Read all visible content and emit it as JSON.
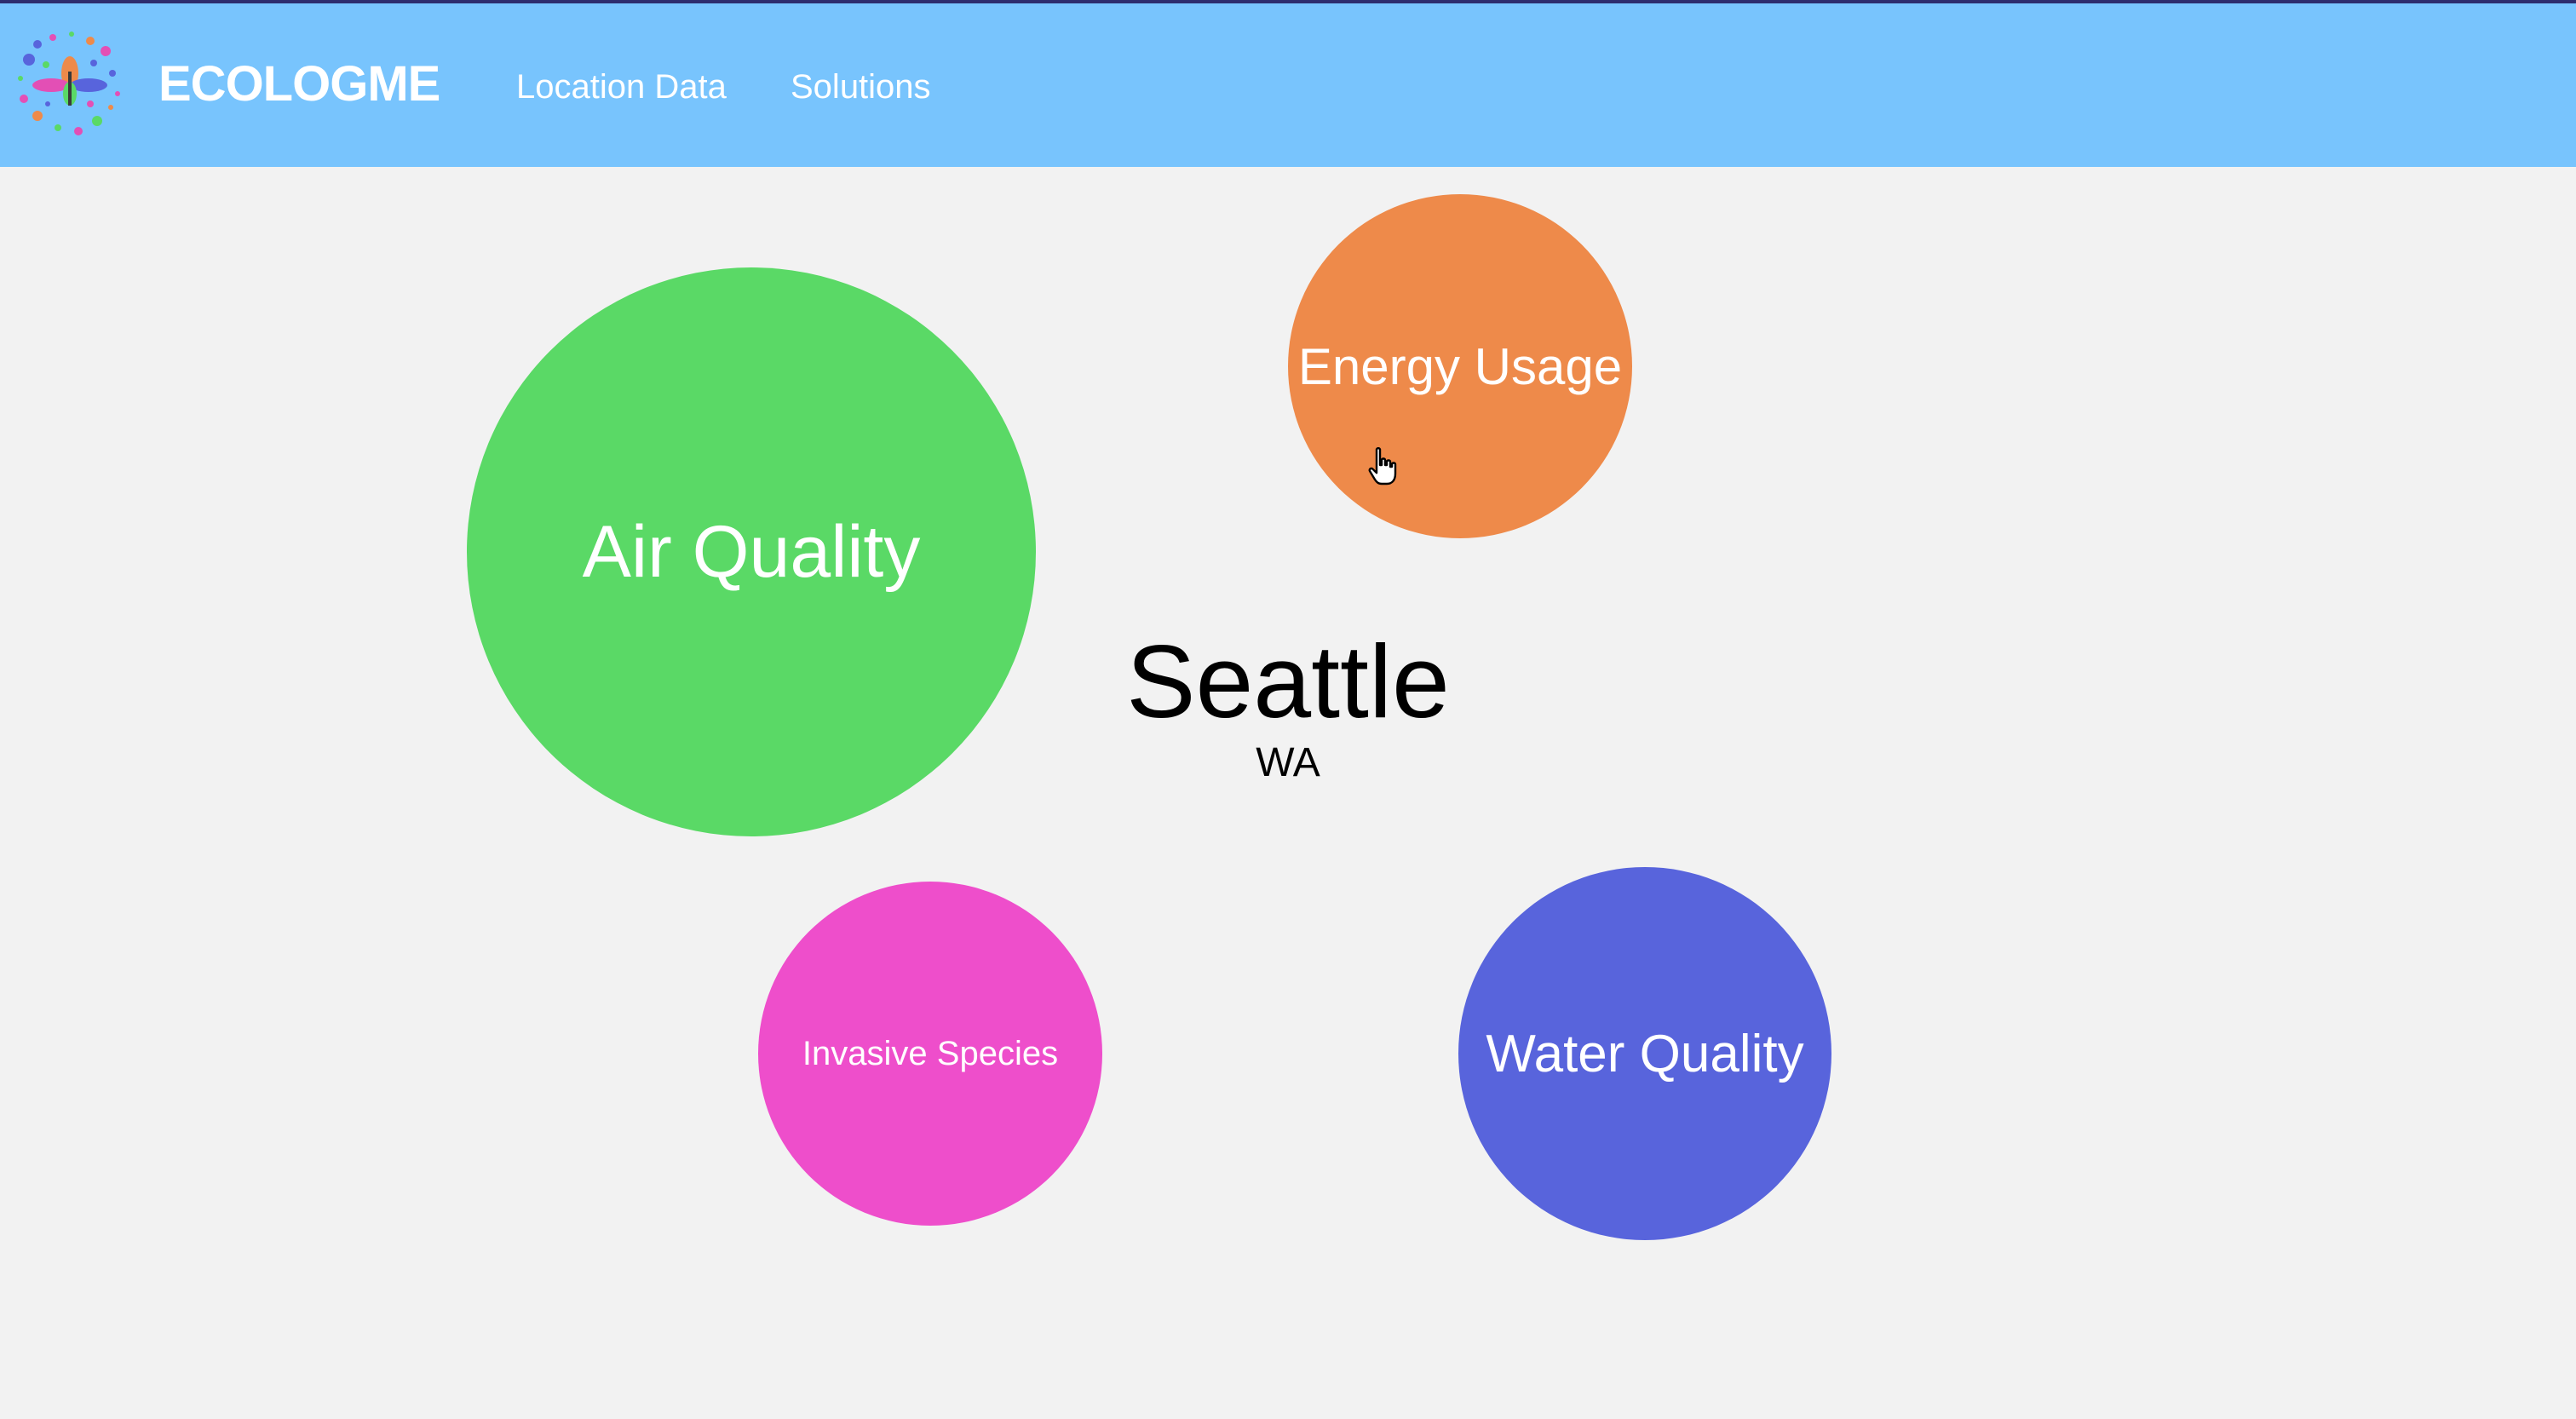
{
  "header": {
    "brand": "ECOLOGME",
    "nav": [
      {
        "label": "Location Data"
      },
      {
        "label": "Solutions"
      }
    ],
    "background_color": "#78c4fd"
  },
  "location": {
    "city": "Seattle",
    "state": "WA"
  },
  "categories": [
    {
      "label": "Air Quality",
      "color": "#5ad966"
    },
    {
      "label": "Energy Usage",
      "color": "#ee8a4a"
    },
    {
      "label": "Invasive Species",
      "color": "#ee4ecb"
    },
    {
      "label": "Water Quality",
      "color": "#5864dc"
    }
  ],
  "cursor": {
    "icon": "hand-pointer-icon"
  }
}
